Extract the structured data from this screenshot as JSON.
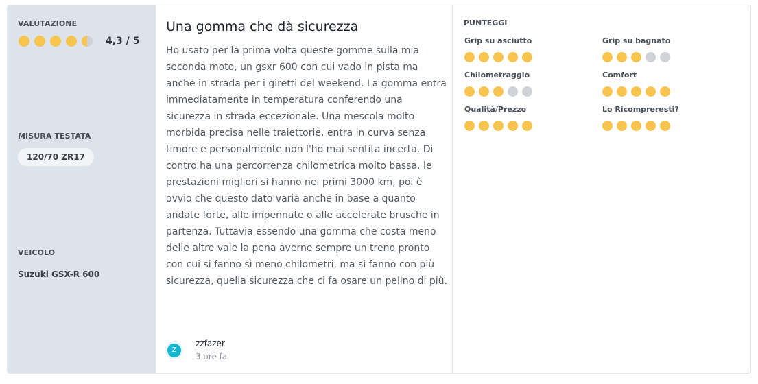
{
  "sidebar": {
    "rating_label": "VALUTAZIONE",
    "rating_value": "4,3 / 5",
    "rating_stars": 4.3,
    "size_label": "MISURA TESTATA",
    "size_value": "120/70 ZR17",
    "vehicle_label": "VEICOLO",
    "vehicle_value": "Suzuki GSX-R 600"
  },
  "review": {
    "title": "Una gomma che dà sicurezza",
    "body": "Ho usato per la prima volta queste gomme sulla mia seconda moto, un gsxr 600 con cui vado in pista ma anche in strada per i giretti del weekend. La gomma entra immediatamente in temperatura conferendo una sicurezza in strada eccezionale. Una mescola molto morbida precisa nelle traiettorie, entra in curva senza timore e personalmente non l'ho mai sentita incerta. Di contro ha una percorrenza chilometrica molto bassa, le prestazioni migliori si hanno nei primi 3000 km, poi è ovvio che questo dato varia anche in base a quanto andate forte, alle impennate o alle accelerate brusche in partenza. Tuttavia essendo una gomma che costa meno delle altre vale la pena averne sempre un treno pronto con cui si fanno sì meno chilometri, ma si fanno con più sicurezza, quella sicurezza che ci fa osare un pelino di più.",
    "author": "zzfazer",
    "avatar_letter": "Z",
    "time": "3 ore fa"
  },
  "scores": {
    "title": "PUNTEGGI",
    "items": [
      {
        "label": "Grip su asciutto",
        "value": 5
      },
      {
        "label": "Grip su bagnato",
        "value": 3
      },
      {
        "label": "Chilometraggio",
        "value": 3
      },
      {
        "label": "Comfort",
        "value": 5
      },
      {
        "label": "Qualità/Prezzo",
        "value": 5
      },
      {
        "label": "Lo Ricompreresti?",
        "value": 5
      }
    ]
  },
  "colors": {
    "star_full": "#f6c44f",
    "star_empty": "#cfd2d6",
    "avatar": "#17b6d1",
    "sidebar_bg": "#dde3ea"
  }
}
